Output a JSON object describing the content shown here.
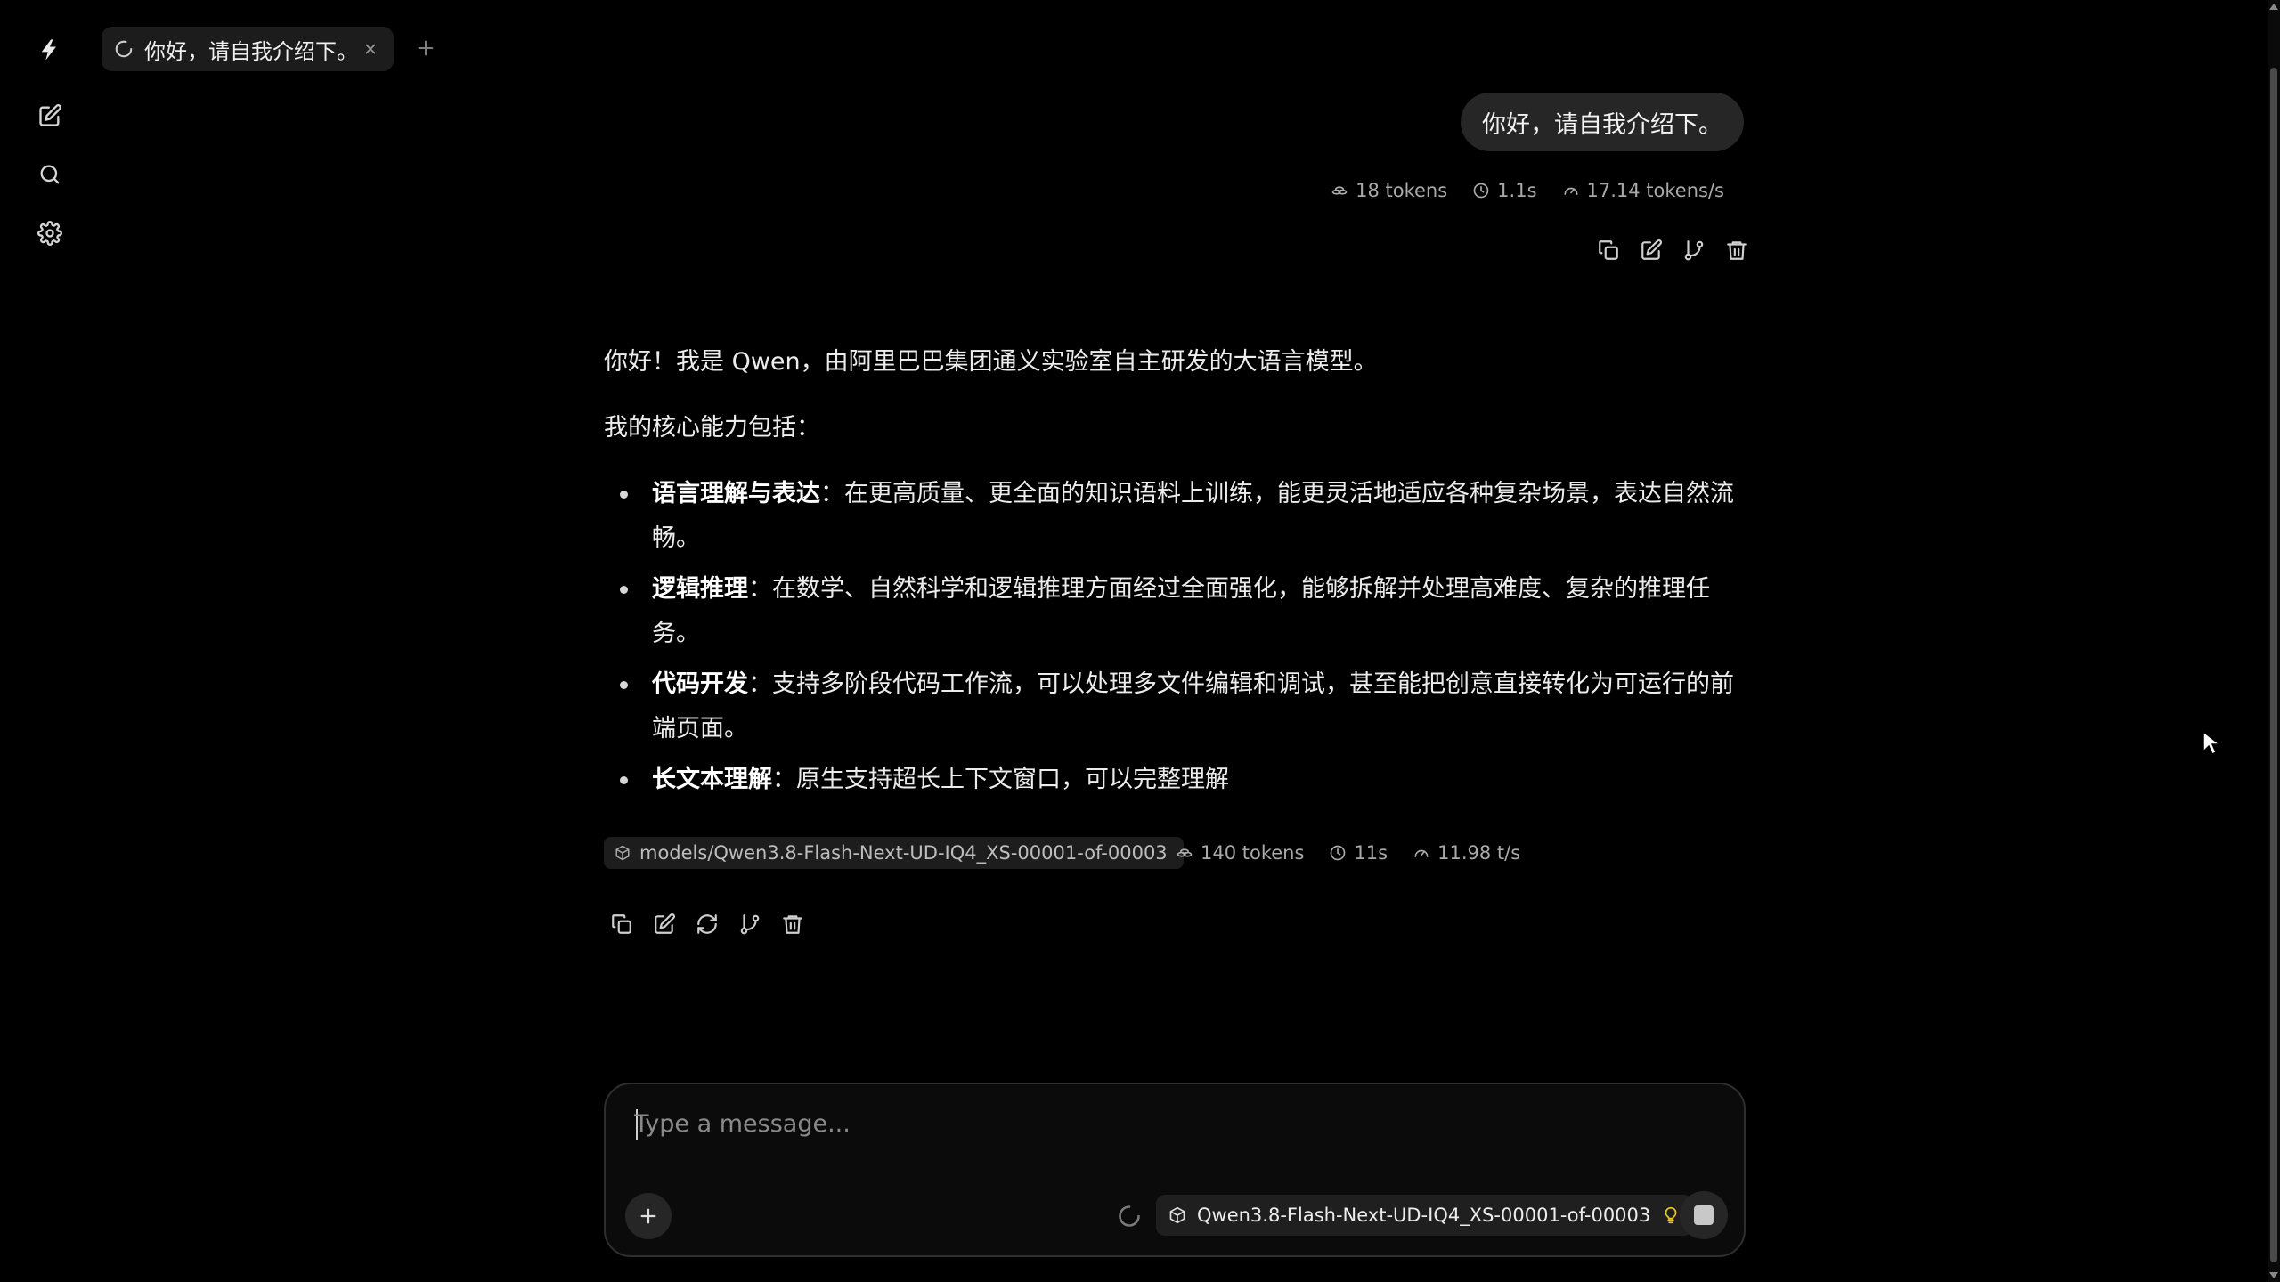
{
  "tab": {
    "title": "你好，请自我介绍下。"
  },
  "user_message": {
    "text": "你好，请自我介绍下。",
    "stats": {
      "tokens": "18 tokens",
      "time": "1.1s",
      "speed": "17.14 tokens/s"
    }
  },
  "assistant_message": {
    "intro": "你好！我是 Qwen，由阿里巴巴集团通义实验室自主研发的大语言模型。",
    "capabilities_heading": "我的核心能力包括：",
    "capabilities": [
      {
        "title": "语言理解与表达",
        "desc": "：在更高质量、更全面的知识语料上训练，能更灵活地适应各种复杂场景，表达自然流畅。"
      },
      {
        "title": "逻辑推理",
        "desc": "：在数学、自然科学和逻辑推理方面经过全面强化，能够拆解并处理高难度、复杂的推理任务。"
      },
      {
        "title": "代码开发",
        "desc": "：支持多阶段代码工作流，可以处理多文件编辑和调试，甚至能把创意直接转化为可运行的前端页面。"
      },
      {
        "title": "长文本理解",
        "desc": "：原生支持超长上下文窗口，可以完整理解"
      }
    ],
    "model": "models/Qwen3.8-Flash-Next-UD-IQ4_XS-00001-of-00003",
    "stats": {
      "tokens": "140 tokens",
      "time": "11s",
      "speed": "11.98 t/s"
    }
  },
  "composer": {
    "placeholder": "Type a message...",
    "model": "Qwen3.8-Flash-Next-UD-IQ4_XS-00001-of-00003"
  },
  "icons": {
    "app_logo": "lightning-icon",
    "new_chat": "edit-icon",
    "search": "search-icon",
    "settings": "gear-icon",
    "reasoning": "lightbulb-icon"
  },
  "colors": {
    "background": "#000000",
    "bubble": "#262626",
    "accent_bulb": "#e6c22a"
  }
}
